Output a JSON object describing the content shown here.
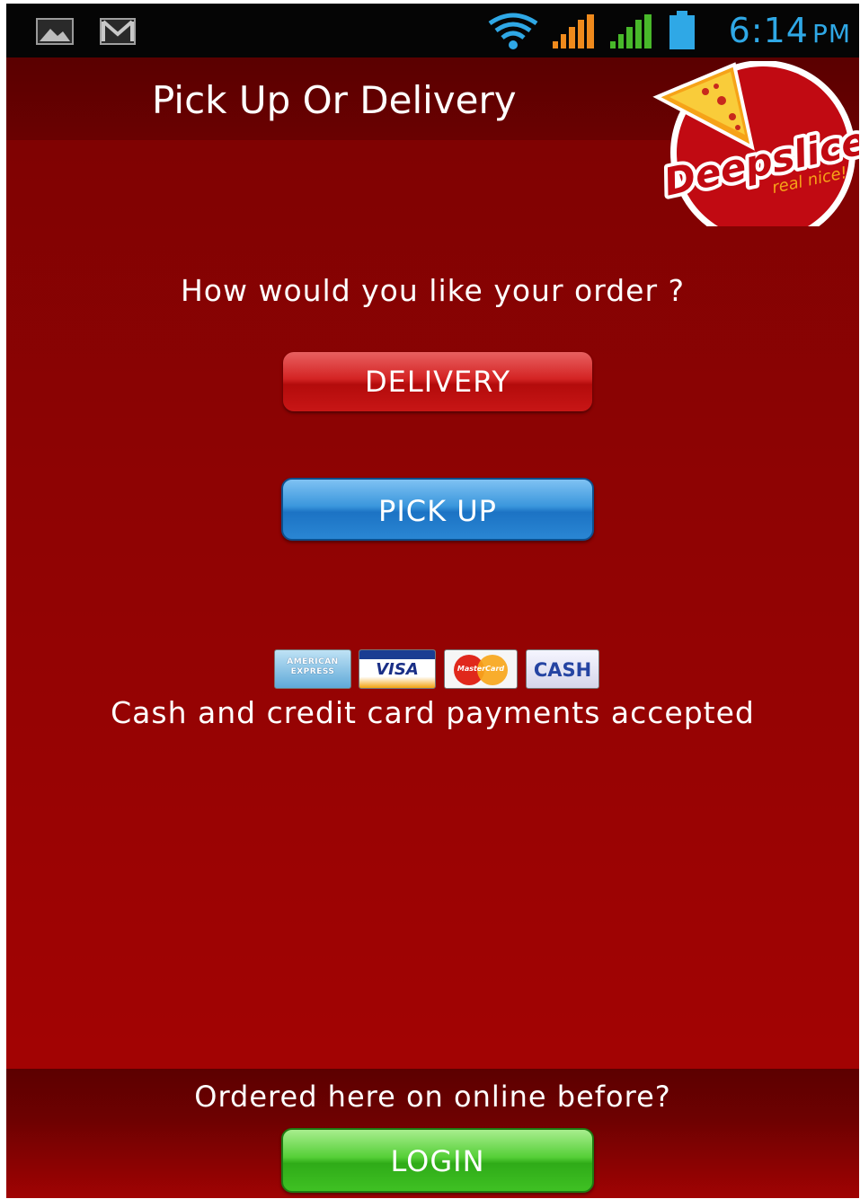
{
  "status_bar": {
    "time": "6:14",
    "ampm": "PM",
    "icons": [
      "gallery-icon",
      "gmail-icon",
      "wifi-icon",
      "signal-orange-icon",
      "signal-green-icon",
      "battery-icon"
    ]
  },
  "header": {
    "title": "Pick Up Or Delivery"
  },
  "logo": {
    "brand": "Deepslice",
    "tagline": "real nice!"
  },
  "main": {
    "question": "How would you like your order ?",
    "delivery_label": "DELIVERY",
    "pickup_label": "PICK UP",
    "payment_text": "Cash and credit card payments accepted",
    "cards": {
      "amex_line1": "AMERICAN",
      "amex_line2": "EXPRESS",
      "visa": "VISA",
      "mastercard": "MasterCard",
      "cash": "CASH"
    }
  },
  "footer": {
    "prompt": "Ordered here on online before?",
    "login_label": "LOGIN"
  },
  "colors": {
    "background": "#9a0202",
    "header": "#5a0000",
    "delivery_button": "#c81616",
    "pickup_button": "#2a86d3",
    "login_button": "#3fc123",
    "time_text": "#2fa8e6"
  }
}
